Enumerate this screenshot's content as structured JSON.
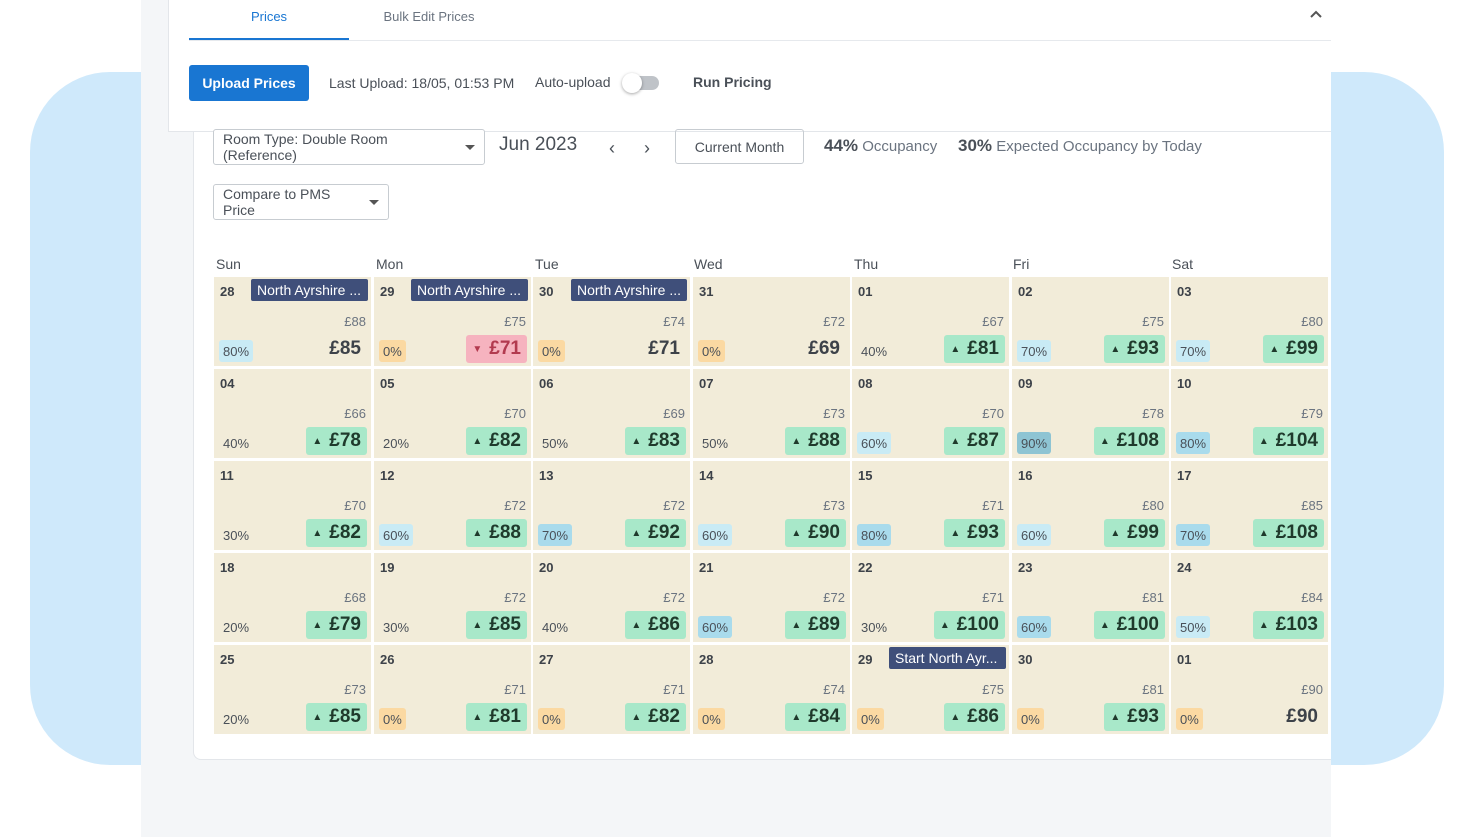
{
  "tabs": [
    {
      "label": "Prices"
    },
    {
      "label": "Bulk Edit Prices"
    }
  ],
  "toolbar": {
    "upload_label": "Upload Prices",
    "last_upload_label": "Last Upload:",
    "last_upload_value": "18/05, 01:53 PM",
    "auto_upload_label": "Auto-upload",
    "auto_upload_on": false,
    "run_pricing_label": "Run Pricing"
  },
  "filters": {
    "room_type": "Room Type: Double Room (Reference)",
    "month": "Jun 2023",
    "current_month_label": "Current Month",
    "compare": "Compare to PMS Price",
    "occupancy_value": "44%",
    "occupancy_label": "Occupancy",
    "expected_value": "30%",
    "expected_label": "Expected Occupancy by Today"
  },
  "weekdays": [
    "Sun",
    "Mon",
    "Tue",
    "Wed",
    "Thu",
    "Fri",
    "Sat"
  ],
  "colors": {
    "accent": "#1976d2",
    "cell_bg": "#f2ecd9",
    "price_up": "#a8e8c9",
    "price_down": "#f6b3bf",
    "event_bg": "#3f4f7a"
  },
  "weeks": [
    [
      {
        "date": "28",
        "event": "North Ayrshire ...",
        "pms": "£88",
        "occ": "80%",
        "occ_style": "light",
        "price": "£85",
        "trend": "none"
      },
      {
        "date": "29",
        "event": "North Ayrshire ...",
        "pms": "£75",
        "occ": "0%",
        "occ_style": "orange",
        "price": "£71",
        "trend": "down"
      },
      {
        "date": "30",
        "event": "North Ayrshire ...",
        "pms": "£74",
        "occ": "0%",
        "occ_style": "orange",
        "price": "£71",
        "trend": "none"
      },
      {
        "date": "31",
        "pms": "£72",
        "occ": "0%",
        "occ_style": "orange",
        "price": "£69",
        "trend": "none"
      },
      {
        "date": "01",
        "pms": "£67",
        "occ": "40%",
        "occ_style": "plain",
        "price": "£81",
        "trend": "up"
      },
      {
        "date": "02",
        "pms": "£75",
        "occ": "70%",
        "occ_style": "light",
        "price": "£93",
        "trend": "up"
      },
      {
        "date": "03",
        "pms": "£80",
        "occ": "70%",
        "occ_style": "light",
        "price": "£99",
        "trend": "up"
      }
    ],
    [
      {
        "date": "04",
        "pms": "£66",
        "occ": "40%",
        "occ_style": "plain",
        "price": "£78",
        "trend": "up"
      },
      {
        "date": "05",
        "pms": "£70",
        "occ": "20%",
        "occ_style": "plain",
        "price": "£82",
        "trend": "up"
      },
      {
        "date": "06",
        "pms": "£69",
        "occ": "50%",
        "occ_style": "plain",
        "price": "£83",
        "trend": "up"
      },
      {
        "date": "07",
        "pms": "£73",
        "occ": "50%",
        "occ_style": "plain",
        "price": "£88",
        "trend": "up"
      },
      {
        "date": "08",
        "pms": "£70",
        "occ": "60%",
        "occ_style": "light",
        "price": "£87",
        "trend": "up"
      },
      {
        "date": "09",
        "pms": "£78",
        "occ": "90%",
        "occ_style": "dark",
        "price": "£108",
        "trend": "up"
      },
      {
        "date": "10",
        "pms": "£79",
        "occ": "80%",
        "occ_style": "mid",
        "price": "£104",
        "trend": "up"
      }
    ],
    [
      {
        "date": "11",
        "pms": "£70",
        "occ": "30%",
        "occ_style": "plain",
        "price": "£82",
        "trend": "up"
      },
      {
        "date": "12",
        "pms": "£72",
        "occ": "60%",
        "occ_style": "light",
        "price": "£88",
        "trend": "up"
      },
      {
        "date": "13",
        "pms": "£72",
        "occ": "70%",
        "occ_style": "mid",
        "price": "£92",
        "trend": "up"
      },
      {
        "date": "14",
        "pms": "£73",
        "occ": "60%",
        "occ_style": "light",
        "price": "£90",
        "trend": "up"
      },
      {
        "date": "15",
        "pms": "£71",
        "occ": "80%",
        "occ_style": "mid",
        "price": "£93",
        "trend": "up"
      },
      {
        "date": "16",
        "pms": "£80",
        "occ": "60%",
        "occ_style": "light",
        "price": "£99",
        "trend": "up"
      },
      {
        "date": "17",
        "pms": "£85",
        "occ": "70%",
        "occ_style": "mid",
        "price": "£108",
        "trend": "up"
      }
    ],
    [
      {
        "date": "18",
        "pms": "£68",
        "occ": "20%",
        "occ_style": "plain",
        "price": "£79",
        "trend": "up"
      },
      {
        "date": "19",
        "pms": "£72",
        "occ": "30%",
        "occ_style": "plain",
        "price": "£85",
        "trend": "up"
      },
      {
        "date": "20",
        "pms": "£72",
        "occ": "40%",
        "occ_style": "plain",
        "price": "£86",
        "trend": "up"
      },
      {
        "date": "21",
        "pms": "£72",
        "occ": "60%",
        "occ_style": "mid",
        "price": "£89",
        "trend": "up"
      },
      {
        "date": "22",
        "pms": "£71",
        "occ": "30%",
        "occ_style": "plain",
        "price": "£100",
        "trend": "up"
      },
      {
        "date": "23",
        "pms": "£81",
        "occ": "60%",
        "occ_style": "mid",
        "price": "£100",
        "trend": "up"
      },
      {
        "date": "24",
        "pms": "£84",
        "occ": "50%",
        "occ_style": "light",
        "price": "£103",
        "trend": "up"
      }
    ],
    [
      {
        "date": "25",
        "pms": "£73",
        "occ": "20%",
        "occ_style": "plain",
        "price": "£85",
        "trend": "up"
      },
      {
        "date": "26",
        "pms": "£71",
        "occ": "0%",
        "occ_style": "orange",
        "price": "£81",
        "trend": "up"
      },
      {
        "date": "27",
        "pms": "£71",
        "occ": "0%",
        "occ_style": "orange",
        "price": "£82",
        "trend": "up"
      },
      {
        "date": "28",
        "pms": "£74",
        "occ": "0%",
        "occ_style": "orange",
        "price": "£84",
        "trend": "up"
      },
      {
        "date": "29",
        "event": "Start North Ayr...",
        "pms": "£75",
        "occ": "0%",
        "occ_style": "orange",
        "price": "£86",
        "trend": "up"
      },
      {
        "date": "30",
        "pms": "£81",
        "occ": "0%",
        "occ_style": "orange",
        "price": "£93",
        "trend": "up"
      },
      {
        "date": "01",
        "pms": "£90",
        "occ": "0%",
        "occ_style": "orange",
        "price": "£90",
        "trend": "none"
      }
    ]
  ]
}
